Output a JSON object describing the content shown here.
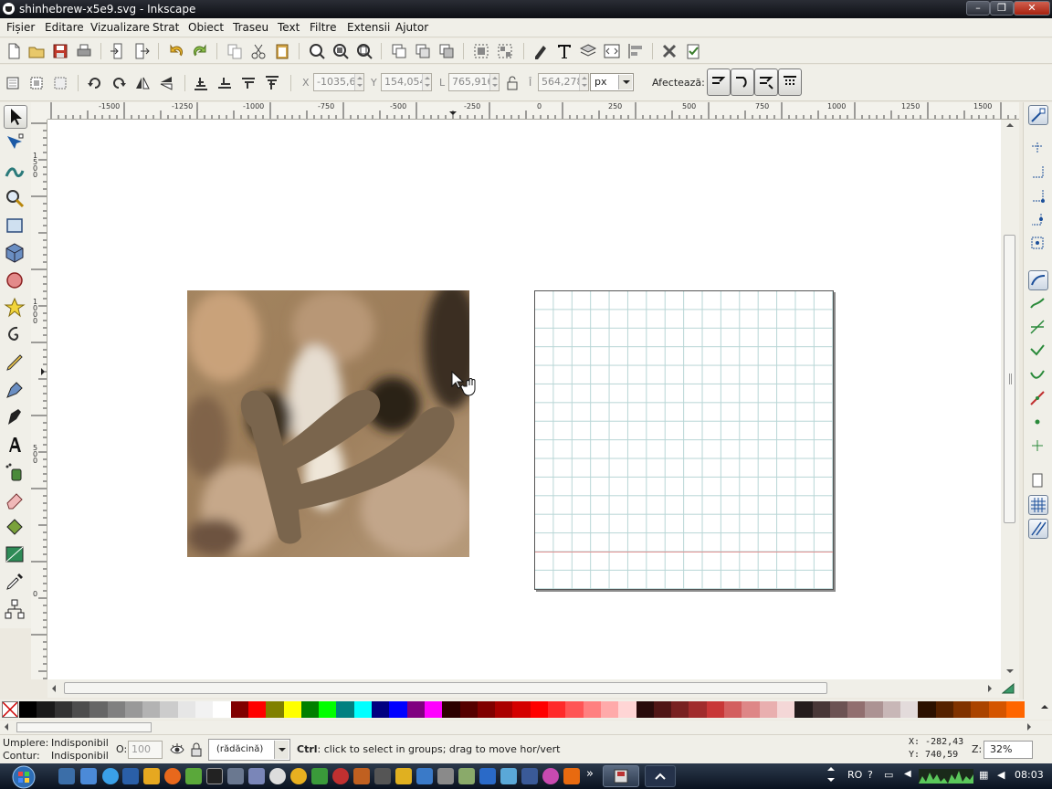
{
  "window": {
    "title": "shinhebrew-x5e9.svg - Inkscape"
  },
  "menu": [
    "Fișier",
    "Editare",
    "Vizualizare",
    "Strat",
    "Obiect",
    "Traseu",
    "Text",
    "Filtre",
    "Extensii",
    "Ajutor"
  ],
  "controls": {
    "x_label": "X",
    "x_value": "-1035,6",
    "y_label": "Y",
    "y_value": "154,054",
    "w_label": "L",
    "w_value": "765,916",
    "h_label": "Î",
    "h_value": "564,278",
    "unit": "px",
    "affects_label": "Afectează:"
  },
  "ruler": {
    "h_labels": [
      "-1500",
      "-1250",
      "-1000",
      "-750",
      "-500",
      "-250",
      "0",
      "250",
      "500",
      "750",
      "1000",
      "1250",
      "1500"
    ],
    "v_labels": [
      "1500",
      "1000",
      "500",
      "0"
    ]
  },
  "palette": [
    "#000000",
    "#1a1a1a",
    "#333333",
    "#4d4d4d",
    "#666666",
    "#808080",
    "#999999",
    "#b3b3b3",
    "#cccccc",
    "#e6e6e6",
    "#f2f2f2",
    "#ffffff",
    "#800000",
    "#ff0000",
    "#808000",
    "#ffff00",
    "#008000",
    "#00ff00",
    "#008080",
    "#00ffff",
    "#000080",
    "#0000ff",
    "#800080",
    "#ff00ff",
    "#2b0000",
    "#550000",
    "#800000",
    "#aa0000",
    "#d40000",
    "#ff0000",
    "#ff2a2a",
    "#ff5555",
    "#ff8080",
    "#ffaaaa",
    "#ffd5d5",
    "#280b0b",
    "#501616",
    "#782121",
    "#a02c2c",
    "#c83737",
    "#d35f5f",
    "#de8787",
    "#e9afaf",
    "#f4d7d7",
    "#241c1c",
    "#483737",
    "#6c5353",
    "#916f6f",
    "#ac9393",
    "#c8b7b7",
    "#e3dbdb",
    "#2b1100",
    "#552200",
    "#803300",
    "#aa4400",
    "#d45500",
    "#ff6600"
  ],
  "status": {
    "fill_label": "Umplere:",
    "fill_value": "Indisponibil",
    "stroke_label": "Contur:",
    "stroke_value": "Indisponibil",
    "opacity_label": "O:",
    "opacity_value": "100",
    "layer": "(rădăcină)",
    "message_key": "Ctrl",
    "message": ": click to select in groups; drag to move hor/vert",
    "cursor_x": "X: -282,43",
    "cursor_y": "Y:  740,59",
    "zoom_label": "Z:",
    "zoom_value": "32%"
  },
  "taskbar": {
    "language": "RO",
    "clock": "08:03"
  },
  "icons": {
    "toolbox": [
      "selector-tool-icon",
      "node-tool-icon",
      "tweak-tool-icon",
      "zoom-tool-icon",
      "rectangle-tool-icon",
      "3d-box-tool-icon",
      "ellipse-tool-icon",
      "star-tool-icon",
      "spiral-tool-icon",
      "pencil-tool-icon",
      "pen-tool-icon",
      "calligraphy-tool-icon",
      "text-tool-icon",
      "spray-tool-icon",
      "eraser-tool-icon",
      "paint-bucket-tool-icon",
      "gradient-tool-icon",
      "dropper-tool-icon",
      "connector-tool-icon"
    ]
  },
  "colors": {
    "grid": "#b8d6d6",
    "guide": "#e09090",
    "shape_fill": "#7a654d"
  }
}
